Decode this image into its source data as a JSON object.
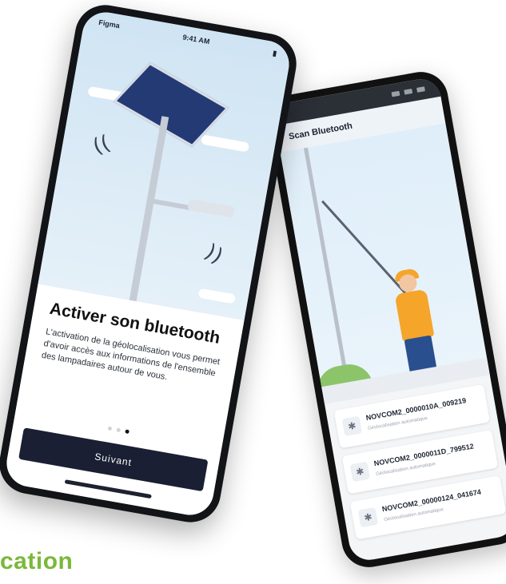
{
  "front_phone": {
    "status": {
      "carrier": "Figma",
      "time": "9:41 AM"
    },
    "heading": "Activer son bluetooth",
    "description": "L'activation de la géolocalisation vous permet d'avoir accès aux informations de l'ensemble des lampadaires autour de vous.",
    "pager": {
      "count": 3,
      "active_index": 2
    },
    "button_label": "Suivant"
  },
  "back_phone": {
    "title": "Scan Bluetooth",
    "devices": [
      {
        "name": "NOVCOM2_0000010A_009219",
        "subtitle": "Géolocalisation automatique"
      },
      {
        "name": "NOVCOM2_0000011D_799512",
        "subtitle": "Géolocalisation automatique"
      },
      {
        "name": "NOVCOM2_00000124_041674",
        "subtitle": "Géolocalisation automatique"
      }
    ]
  },
  "cropped_heading": "cation",
  "colors": {
    "accent_green": "#7ab83a",
    "button_navy": "#1a1f33",
    "solar_panel": "#233a75",
    "worker_vest": "#f4a52a"
  }
}
